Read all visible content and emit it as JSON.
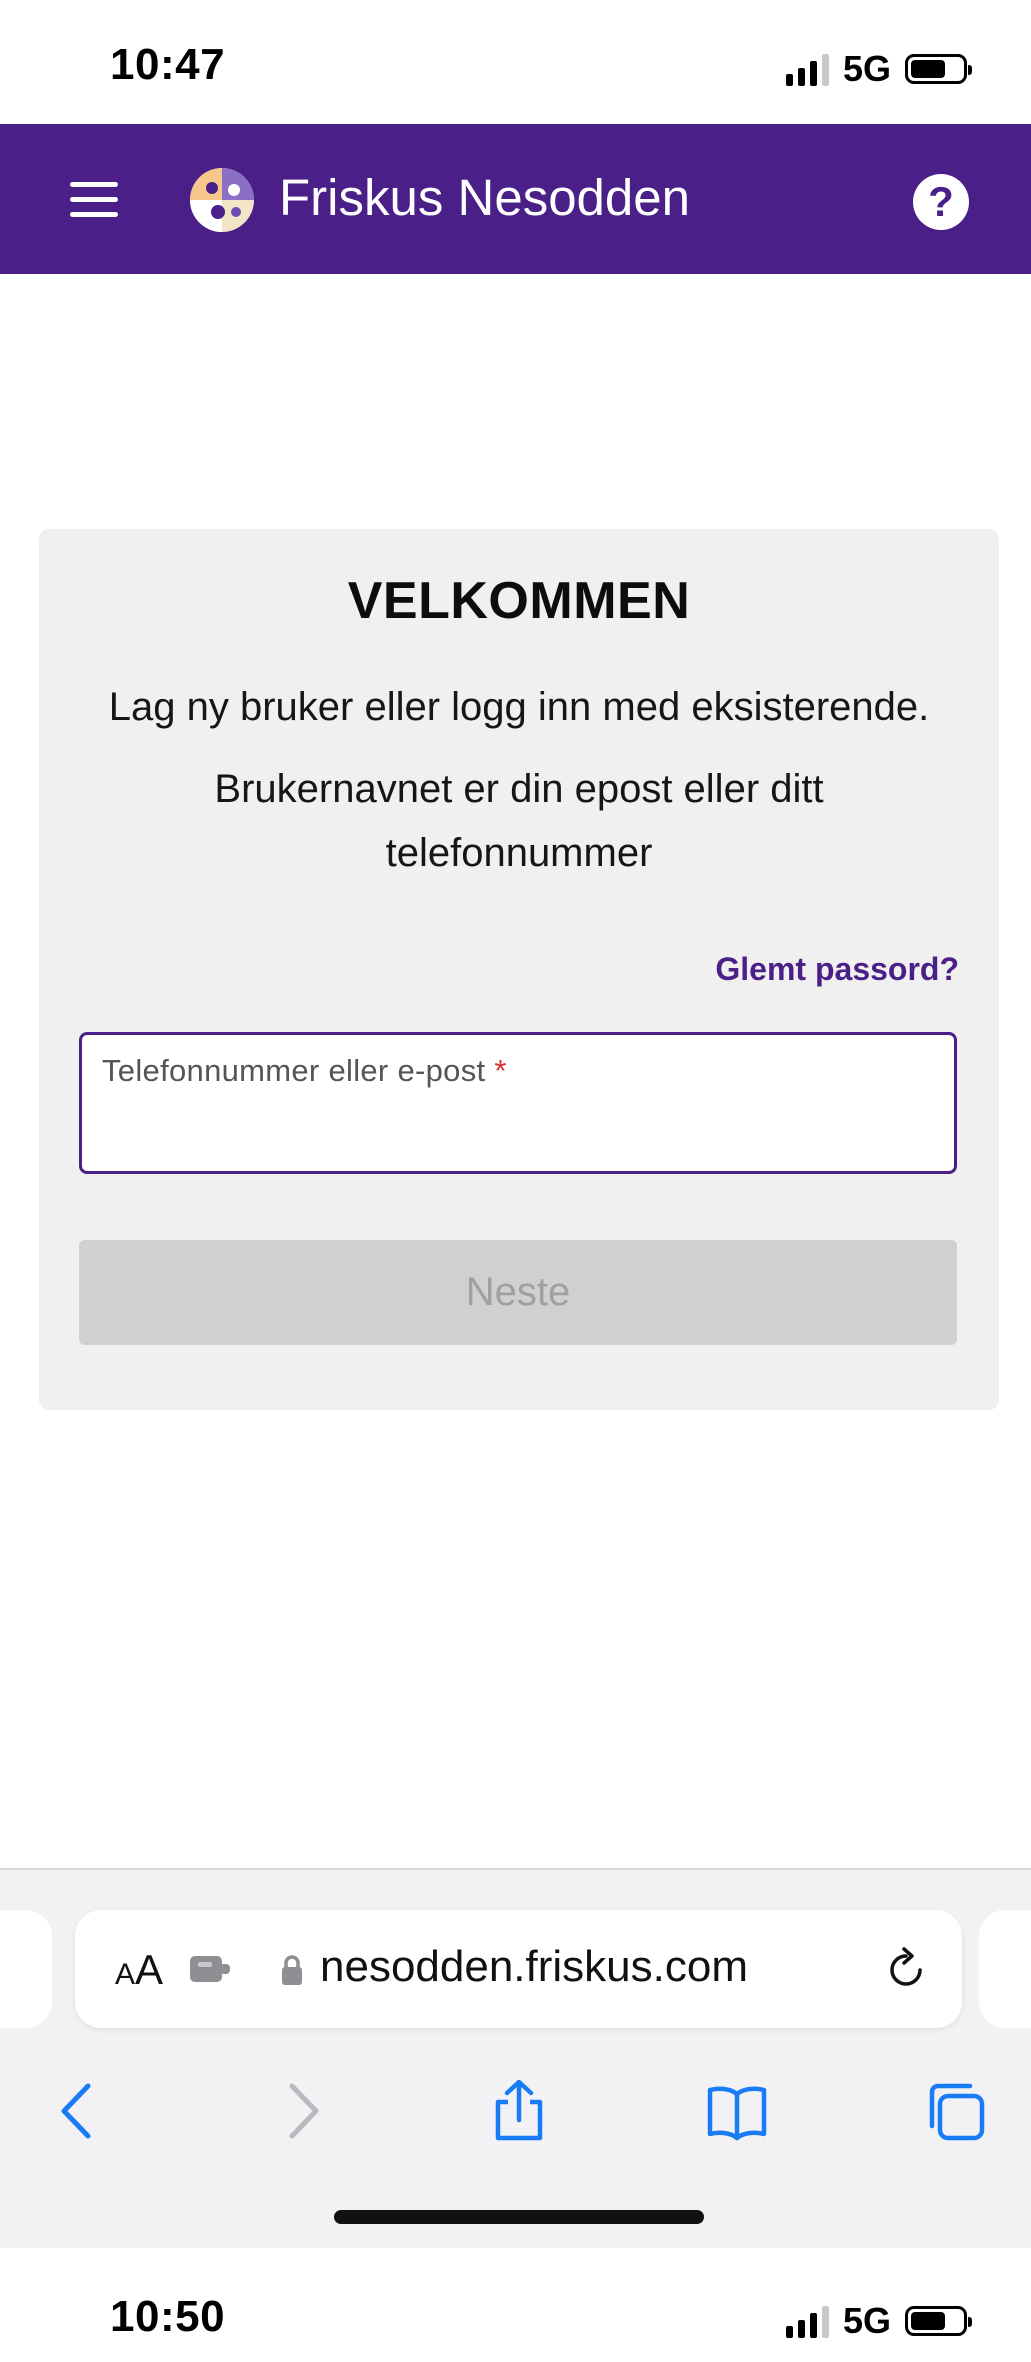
{
  "status_bar_top": {
    "time": "10:47",
    "network": "5G"
  },
  "header": {
    "app_name": "Friskus Nesodden",
    "help_symbol": "?"
  },
  "card": {
    "title": "VELKOMMEN",
    "subtitle": "Lag ny bruker eller logg inn med eksisterende.",
    "hint": "Brukernavnet er din epost eller ditt telefonnummer",
    "forgot_password": "Glemt passord?",
    "input": {
      "label": "Telefonnummer eller e-post",
      "required_mark": "*",
      "value": ""
    },
    "next_button": "Neste"
  },
  "safari": {
    "text_size_small": "A",
    "text_size_big": "A",
    "url": "nesodden.friskus.com"
  },
  "status_bar_bottom": {
    "time": "10:50",
    "network": "5G"
  },
  "colors": {
    "brand": "#4a1f87",
    "card_bg": "#f0f0f0",
    "disabled_button": "#d0d0d0",
    "ios_blue": "#1a7cf5"
  }
}
